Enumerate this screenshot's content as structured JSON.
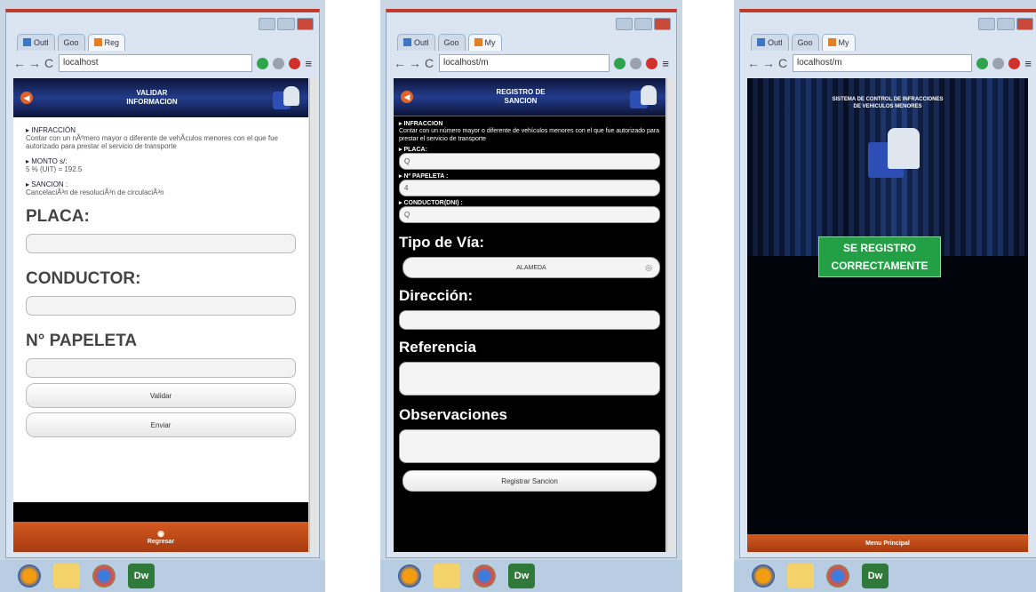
{
  "taskbar": {
    "dreamweaver_label": "Dw"
  },
  "screen1": {
    "tabs": [
      "Outl",
      "Goo",
      "Reg"
    ],
    "url": "localhost",
    "header_title": [
      "VALIDAR",
      "INFORMACION"
    ],
    "infraccion_label": "INFRACCIÓN",
    "infraccion_text": "Contar con un nÃºmero mayor o diferente de vehÃ­culos menores con el que fue autorizado para prestar el servicio de transporte",
    "monto_label": "MONTO s/:",
    "monto_text": "5 % (UIT) = 192.5",
    "sancion_label": "SANCION :",
    "sancion_text": "CancelaciÃ³n de resoluciÃ³n de circulaciÃ³n",
    "placa_label": "PLACA:",
    "conductor_label": "CONDUCTOR:",
    "papeleta_label": "N° PAPELETA",
    "validar_button": "Validar",
    "enviar_button": "Enviar",
    "footer_label": "Regresar"
  },
  "screen2": {
    "tabs": [
      "Outl",
      "Goo",
      "My"
    ],
    "url": "localhost/m",
    "header_title": [
      "REGISTRO DE",
      "SANCION"
    ],
    "infraccion_label": "INFRACCION",
    "infraccion_text": "Contar con un número mayor o diferente de vehículos menores con el que fue autorizado para prestar el servicio de transporte",
    "placa_label": "PLACA:",
    "placa_value": "Q",
    "papeleta_label": "Nº PAPELETA :",
    "papeleta_value": "4",
    "conductor_label": "CONDUCTOR(DNI) :",
    "conductor_value": "Q",
    "tipo_via_label": "Tipo de Vía:",
    "tipo_via_value": "ALAMEDA",
    "direccion_label": "Dirección:",
    "referencia_label": "Referencia",
    "observaciones_label": "Observaciones",
    "registrar_button": "Registrar Sancion"
  },
  "screen3": {
    "tabs": [
      "Outl",
      "Goo",
      "My"
    ],
    "url": "localhost/m",
    "system_title": [
      "SISTEMA DE CONTROL DE INFRACCIONES",
      "DE VEHICULOS MENORES"
    ],
    "success_line1": "SE REGISTRO",
    "success_line2": "CORRECTAMENTE",
    "footer_label": "Menu Principal"
  }
}
